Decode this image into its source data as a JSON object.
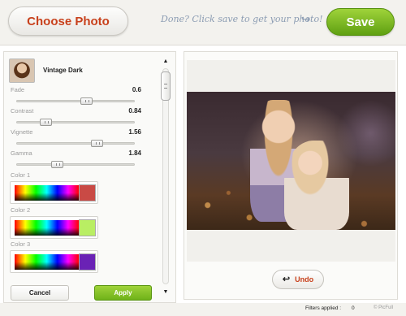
{
  "header": {
    "choose_label": "Choose Photo",
    "hint": "Done? Click save to get your photo!",
    "save_label": "Save"
  },
  "filter": {
    "name": "Vintage Dark",
    "params": [
      {
        "label": "Fade",
        "value": "0.6",
        "level": 0.6
      },
      {
        "label": "Contrast",
        "value": "0.84",
        "level": 0.22
      },
      {
        "label": "Vignette",
        "value": "1.56",
        "level": 0.7
      },
      {
        "label": "Gamma",
        "value": "1.84",
        "level": 0.33
      }
    ],
    "colors": [
      {
        "label": "Color 1",
        "swatch": "#c94a45"
      },
      {
        "label": "Color 2",
        "swatch": "#b9ee63"
      },
      {
        "label": "Color 3",
        "swatch": "#6a22b5"
      }
    ],
    "cancel_label": "Cancel",
    "apply_label": "Apply"
  },
  "scroll": {
    "up": "▲",
    "down": "▼"
  },
  "preview": {
    "undo_label": "Undo",
    "undo_icon": "↩"
  },
  "footer": {
    "filters_label": "Filters applied :",
    "filters_count": "0",
    "brand": "© PicFull"
  }
}
